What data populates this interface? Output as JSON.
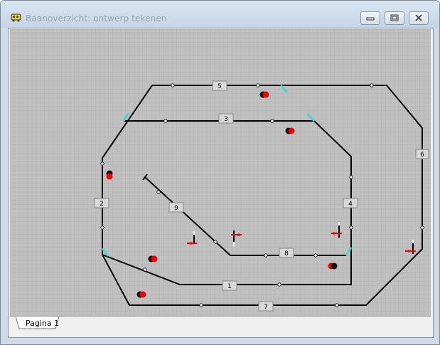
{
  "window": {
    "title": "Baanoverzicht: ontwerp tekenen",
    "controls": {
      "minimize": "minimize-button",
      "maximize": "maximize-button",
      "close": "close-button"
    }
  },
  "layout_editor": {
    "track_labels": [
      "5",
      "3",
      "6",
      "2",
      "9",
      "4",
      "8",
      "1",
      "7"
    ],
    "icons": [
      "track-segment",
      "switch-marker",
      "red-signal-icon",
      "semaphore-signal-icon"
    ]
  },
  "tabs": [
    {
      "label": "Pagina 1",
      "active": true
    }
  ],
  "colors": {
    "grid_background": "#c0c0c0",
    "grid_line": "#b0b0b0",
    "track": "#000000",
    "switch_accent": "#4fd3d3",
    "signal_red": "#e00000"
  }
}
